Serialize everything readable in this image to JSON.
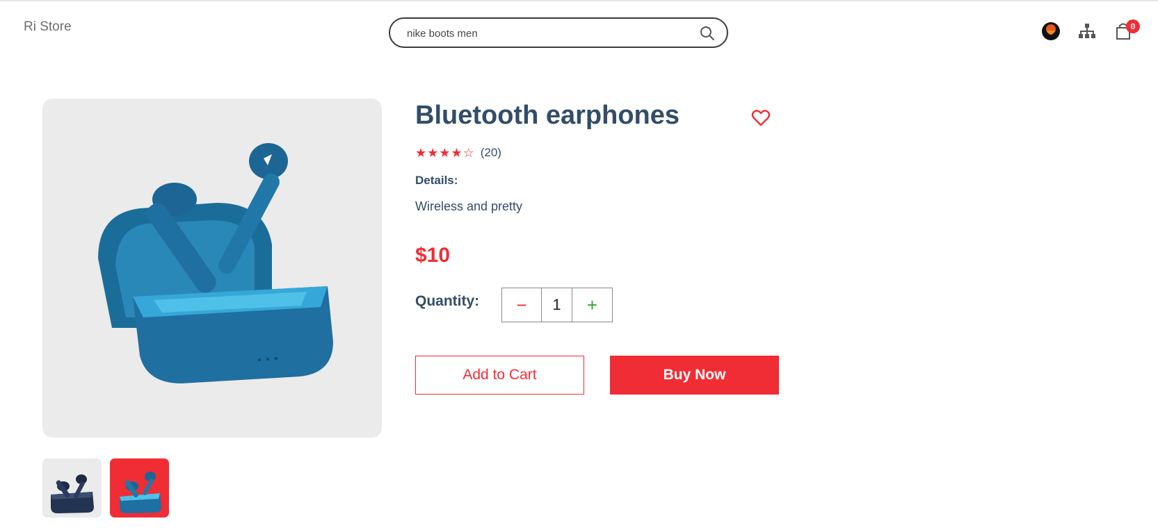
{
  "header": {
    "brand": "Ri Store",
    "search": {
      "value": "nike boots men",
      "icon": "search-icon"
    },
    "cart_count": "0",
    "icons": [
      "user-avatar-icon",
      "sitemap-icon",
      "shopping-bag-icon"
    ]
  },
  "product": {
    "title": "Bluetooth earphones",
    "rating": {
      "stars_filled": 4,
      "stars_total": 5,
      "review_count": "(20)"
    },
    "details_label": "Details:",
    "details_text": "Wireless and pretty",
    "price": "$10",
    "quantity_label": "Quantity:",
    "quantity_value": "1",
    "add_to_cart_label": "Add to Cart",
    "buy_now_label": "Buy Now",
    "thumbnails": [
      {
        "name": "thumbnail-dark-earbuds",
        "background": "#ebebeb"
      },
      {
        "name": "thumbnail-blue-earbuds-selected",
        "background": "#f02d34"
      }
    ]
  },
  "colors": {
    "accent": "#f02d34",
    "text": "#324d67",
    "image_bg": "#ebebeb",
    "plus": "#31a831"
  }
}
